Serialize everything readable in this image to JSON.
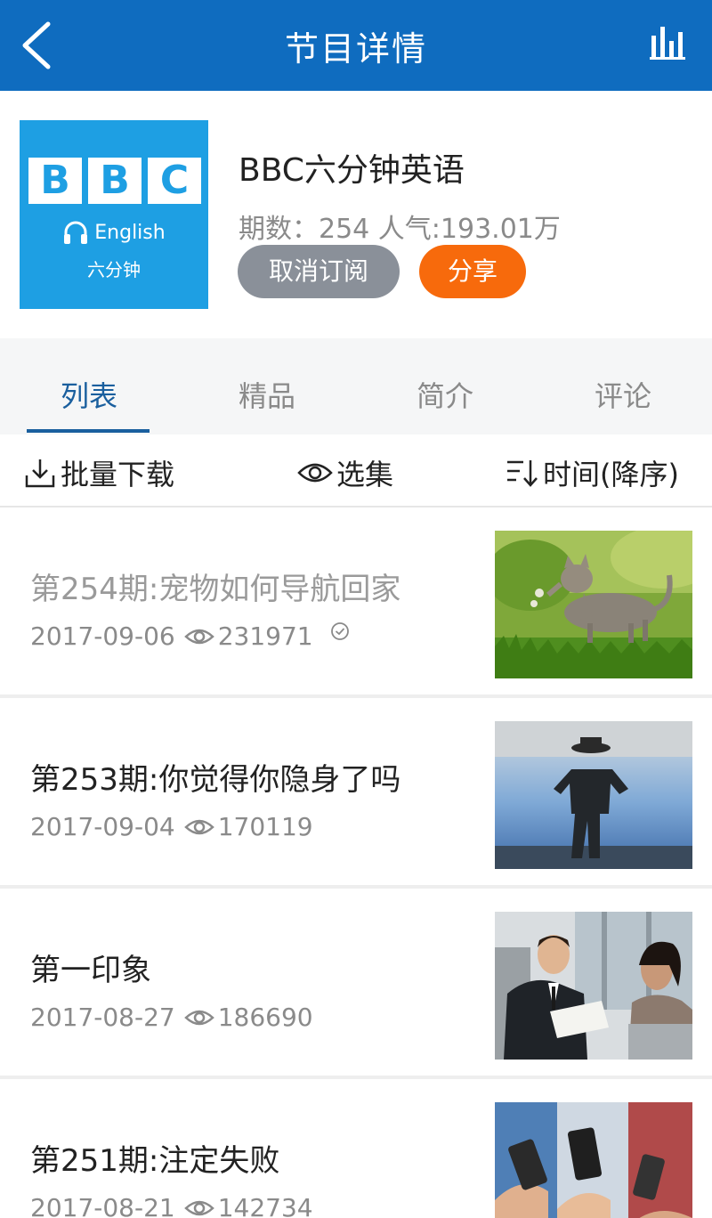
{
  "header": {
    "title": "节目详情",
    "bar_color": "#0f6cbf"
  },
  "program": {
    "cover": {
      "letters": [
        "B",
        "B",
        "C"
      ],
      "english_label": "English",
      "chinese_label": "六分钟",
      "bg_color": "#1e9fe3"
    },
    "title": "BBC六分钟英语",
    "stats": "期数：254 人气:193.01万",
    "unsubscribe_label": "取消订阅",
    "share_label": "分享"
  },
  "tabs": [
    {
      "label": "列表",
      "active": true
    },
    {
      "label": "精品",
      "active": false
    },
    {
      "label": "简介",
      "active": false
    },
    {
      "label": "评论",
      "active": false
    }
  ],
  "toolbar": {
    "batch_download": "批量下载",
    "select_episodes": "选集",
    "sort": "时间(降序)"
  },
  "episodes": [
    {
      "title": "第254期:宠物如何导航回家",
      "date": "2017-09-06",
      "views": "231971",
      "played": true,
      "thumb": "cat-photo"
    },
    {
      "title": "第253期:你觉得你隐身了吗",
      "date": "2017-09-04",
      "views": "170119",
      "played": false,
      "thumb": "invisible-man-photo"
    },
    {
      "title": "第一印象",
      "date": "2017-08-27",
      "views": "186690",
      "played": false,
      "thumb": "business-meeting-photo"
    },
    {
      "title": "第251期:注定失败",
      "date": "2017-08-21",
      "views": "142734",
      "played": false,
      "thumb": "phones-photo"
    }
  ]
}
